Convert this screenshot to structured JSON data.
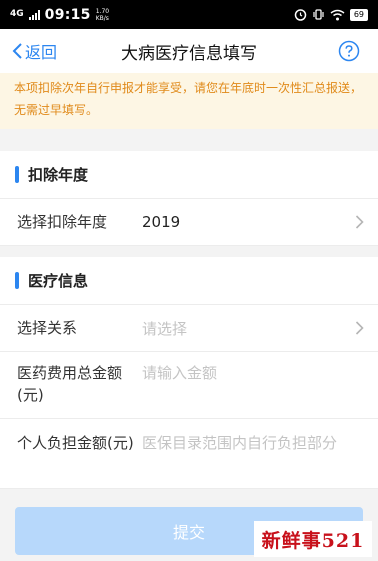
{
  "status_bar": {
    "signal": "4G",
    "time": "09:15",
    "speed_value": "1.70",
    "speed_unit": "KB/s",
    "battery": "69"
  },
  "navbar": {
    "back_label": "返回",
    "title": "大病医疗信息填写"
  },
  "notice": {
    "text": "本项扣除次年自行申报才能享受，请您在年底时一次性汇总报送，无需过早填写。"
  },
  "deduction_section": {
    "title": "扣除年度",
    "year_row": {
      "label": "选择扣除年度",
      "value": "2019"
    }
  },
  "medical_section": {
    "title": "医疗信息",
    "relation_row": {
      "label": "选择关系",
      "placeholder": "请选择"
    },
    "total_cost_row": {
      "label": "医药费用总金额(元)",
      "placeholder": "请输入金额"
    },
    "personal_row": {
      "label": "个人负担金额(元)",
      "placeholder": "医保目录范围内自行负担部分"
    }
  },
  "submit_label": "提交",
  "watermark": "新鲜事521",
  "colors": {
    "accent": "#2c86f0",
    "notice_text": "#e08a1a",
    "notice_bg": "#fdf6e4",
    "submit_disabled": "#b7d8fb"
  },
  "icons": {
    "back": "chevron-left-icon",
    "help": "question-circle-icon",
    "row_arrow": "chevron-right-icon"
  }
}
